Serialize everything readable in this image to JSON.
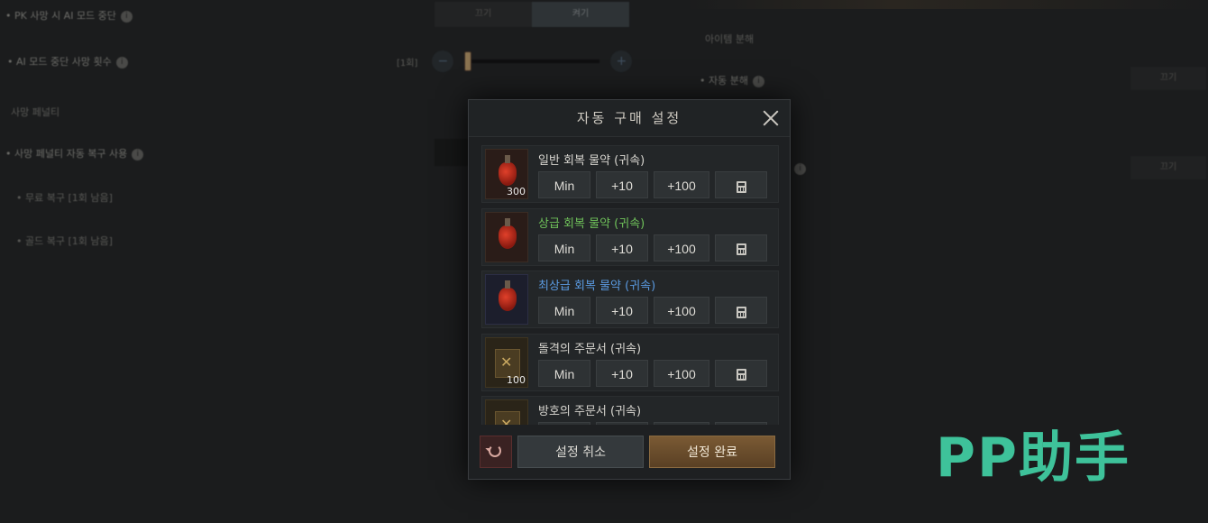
{
  "background": {
    "toggle": [
      "끄기",
      "켜기"
    ],
    "slider_value": "[1회]",
    "toggle_off": "끄기"
  },
  "modal": {
    "title": "자동 구매 설정",
    "items": [
      {
        "name": "일반 회복 물약 (귀속)",
        "qty": "300",
        "color": "#d8d6d0"
      },
      {
        "name": "상급 회복 물약 (귀속)",
        "qty": "",
        "color": "#6fc15a"
      },
      {
        "name": "최상급 회복 물약 (귀속)",
        "qty": "",
        "color": "#5a9ae0"
      },
      {
        "name": "돌격의 주문서 (귀속)",
        "qty": "100",
        "color": "#d8d6d0"
      },
      {
        "name": "방호의 주문서 (귀속)",
        "qty": "",
        "color": "#d8d6d0"
      }
    ],
    "buttons": {
      "min": "Min",
      "plus10": "+10",
      "plus100": "+100"
    },
    "cancel_label": "설정 취소",
    "confirm_label": "설정 완료"
  },
  "watermark": "PP助手"
}
